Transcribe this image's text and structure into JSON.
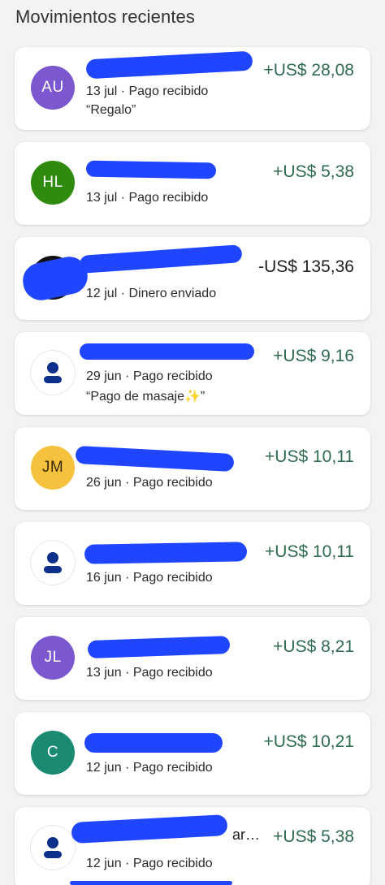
{
  "section": {
    "title": "Movimientos recientes"
  },
  "colors": {
    "positive": "#2f6b4e",
    "negative": "#1f1f1f",
    "redaction": "#1f45ff"
  },
  "transactions": [
    {
      "avatar": "AU",
      "avatar_color": "#7b57d0",
      "meta": "13 jul · Pago recibido",
      "note": "“Regalo”",
      "amount": "+US$ 28,08",
      "sign": "pos"
    },
    {
      "avatar": "HL",
      "avatar_color": "#2f8a10",
      "meta": "13 jul · Pago recibido",
      "note": "",
      "amount": "+US$ 5,38",
      "sign": "pos"
    },
    {
      "avatar": "",
      "avatar_color": "#111111",
      "meta": "12 jul · Dinero enviado",
      "note": "",
      "amount": "-US$ 135,36",
      "sign": "neg"
    },
    {
      "avatar": "person-icon",
      "avatar_color": "#ffffff",
      "meta": "29 jun · Pago recibido",
      "note": "“Pago de masaje✨”",
      "amount": "+US$ 9,16",
      "sign": "pos"
    },
    {
      "avatar": "JM",
      "avatar_color": "#f6c13c",
      "meta": "26 jun · Pago recibido",
      "note": "",
      "amount": "+US$ 10,11",
      "sign": "pos"
    },
    {
      "avatar": "person-icon",
      "avatar_color": "#ffffff",
      "meta": "16 jun · Pago recibido",
      "note": "",
      "amount": "+US$ 10,11",
      "sign": "pos"
    },
    {
      "avatar": "JL",
      "avatar_color": "#7b57d0",
      "meta": "13 jun · Pago recibido",
      "note": "",
      "amount": "+US$ 8,21",
      "sign": "pos"
    },
    {
      "avatar": "C",
      "avatar_color": "#1a8a72",
      "meta": "12 jun · Pago recibido",
      "note": "",
      "amount": "+US$ 10,21",
      "sign": "pos"
    },
    {
      "avatar": "person-icon",
      "avatar_color": "#ffffff",
      "meta": "12 jun · Pago recibido",
      "note": "",
      "amount": "+US$ 5,38",
      "sign": "pos",
      "name_suffix": "ar…"
    }
  ]
}
